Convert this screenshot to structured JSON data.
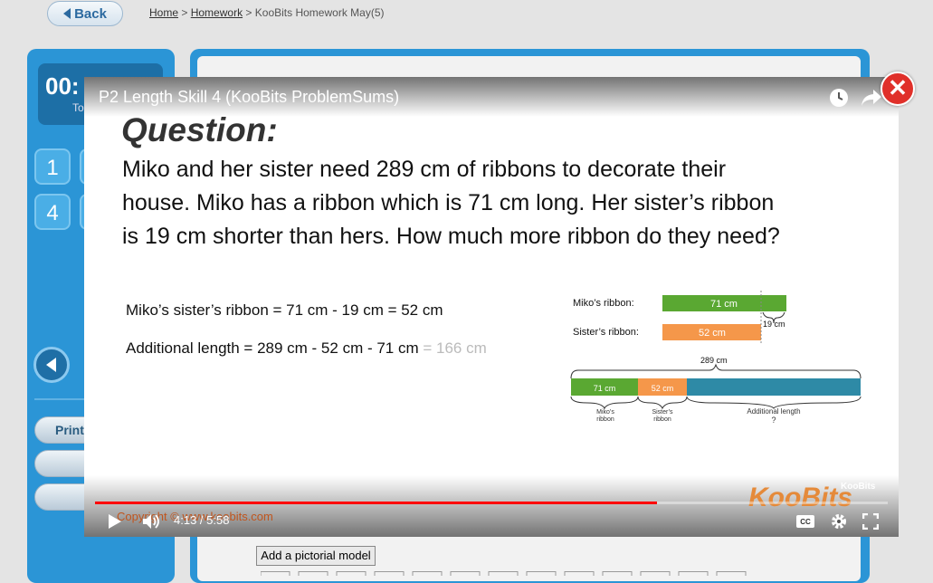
{
  "nav": {
    "back_label": "Back",
    "breadcrumb": {
      "home": "Home",
      "sep1": ">",
      "homework": "Homework",
      "sep2": ">",
      "current": "KooBits Homework May(5)"
    }
  },
  "sidebar": {
    "timer": "00:",
    "timer_sub": "To",
    "question_numbers": [
      "1",
      "4"
    ],
    "print_label": "Print"
  },
  "main": {
    "pictorial_button": "Add a pictorial model"
  },
  "video": {
    "title": "P2 Length Skill 4 (KooBits ProblemSums)",
    "question_heading": "Question:",
    "question_lines": [
      "Miko and her sister need 289 cm of ribbons to decorate their",
      "house. Miko has a ribbon which is 71 cm long. Her sister’s ribbon",
      "is 19 cm shorter than hers. How much more ribbon do they need?"
    ],
    "calc_line1": "Miko’s sister’s ribbon = 71 cm - 19 cm = 52 cm",
    "calc_line2": "Additional length = 289 cm - 52 cm - 71 cm",
    "calc_line2_result": "= 166 cm",
    "model": {
      "miko_label": "Miko’s ribbon:",
      "sister_label": "Sister’s ribbon:",
      "miko_value": "71 cm",
      "sister_value": "52 cm",
      "diff_value": "19 cm",
      "total_value": "289 cm",
      "seg1": "71 cm",
      "seg2": "52 cm",
      "bottom_label1_a": "Miko’s",
      "bottom_label1_b": "ribbon",
      "bottom_label2_a": "Sister’s",
      "bottom_label2_b": "ribbon",
      "bottom_label3": "Additional length",
      "question_mark": "?",
      "colors": {
        "green": "#5aa832",
        "orange": "#f5974a",
        "teal": "#2e8aa6"
      }
    },
    "player": {
      "time": "4:13 / 5:58",
      "progress": 0.709,
      "copyright": "Copyright © www.koobits.com",
      "logo": "KooBits",
      "logo_small": "KooBits"
    }
  },
  "close_label": "✕"
}
